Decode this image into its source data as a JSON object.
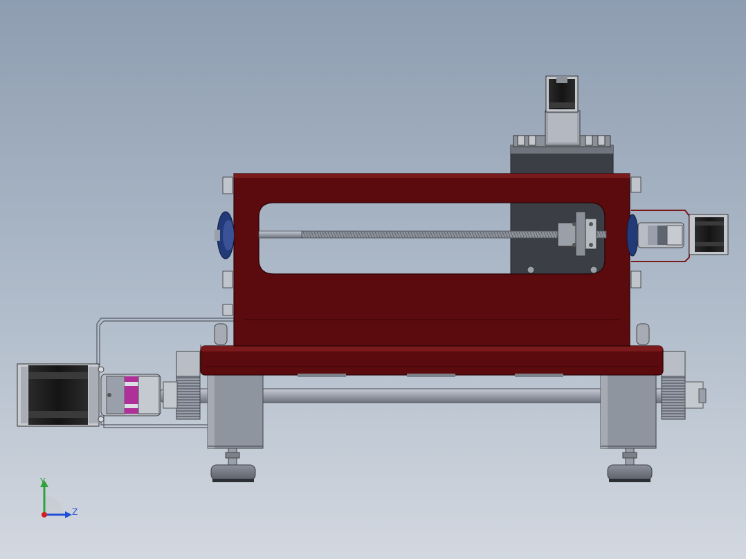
{
  "viewport": {
    "background_top": "#8e9db1",
    "background_bottom": "#d3d8e0"
  },
  "colors": {
    "frame_red": "#5b0a0d",
    "frame_red_light": "#7a1a1c",
    "steel_gray": "#9aa0ab",
    "motor_black": "#1e1e1e",
    "coupling_magenta": "#b0309a",
    "bearing_blue": "#233a78",
    "axis_y": "#2fa23a",
    "axis_z": "#1f4fd6",
    "axis_origin": "#d21e1e"
  },
  "model": {
    "components": [
      "top-stepper-motor",
      "motor-mount-bracket",
      "carriage-block",
      "red-rectangular-frame",
      "lead-screw",
      "lead-screw-nut",
      "right-stepper-motor",
      "right-jaw-coupling",
      "left-bearing-housing",
      "base-rail",
      "guide-shaft",
      "left-stepper-motor",
      "left-jaw-coupling",
      "left-gear",
      "right-gear",
      "left-pillow-block",
      "right-pillow-block",
      "left-leveling-foot",
      "right-leveling-foot",
      "wire-harness"
    ]
  },
  "triad": {
    "y_label": "Y",
    "z_label": "Z"
  }
}
